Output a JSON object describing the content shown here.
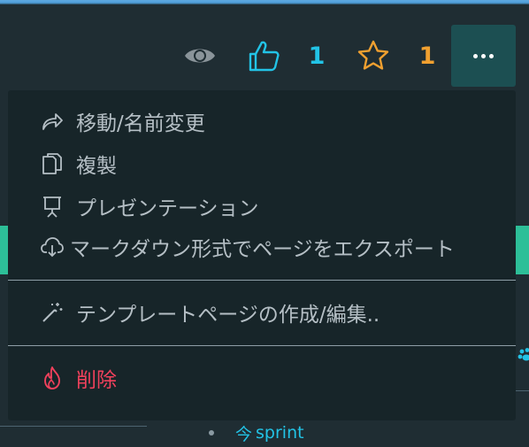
{
  "toolbar": {
    "like_count": "1",
    "bookmark_count": "1",
    "colors": {
      "like": "#22c3e6",
      "bookmark": "#f0a030",
      "more_bg": "#1c4f52"
    },
    "icons": [
      "eye-icon",
      "thumbs-up-icon",
      "star-icon",
      "more-dots-icon"
    ]
  },
  "menu": {
    "move_rename": "移動/名前変更",
    "duplicate": "複製",
    "presentation": "プレゼンテーション",
    "export_markdown": "マークダウン形式でページをエクスポート",
    "template": "テンプレートページの作成/編集..",
    "delete": "削除",
    "icons": [
      "share-arrow-icon",
      "copy-icon",
      "presentation-icon",
      "cloud-download-icon",
      "magic-wand-icon",
      "fire-icon"
    ],
    "colors": {
      "text": "#b5bfc5",
      "delete": "#f0415c",
      "background": "#172529"
    }
  },
  "background_page": {
    "link_prefix": "今",
    "link_text": "sprint"
  }
}
